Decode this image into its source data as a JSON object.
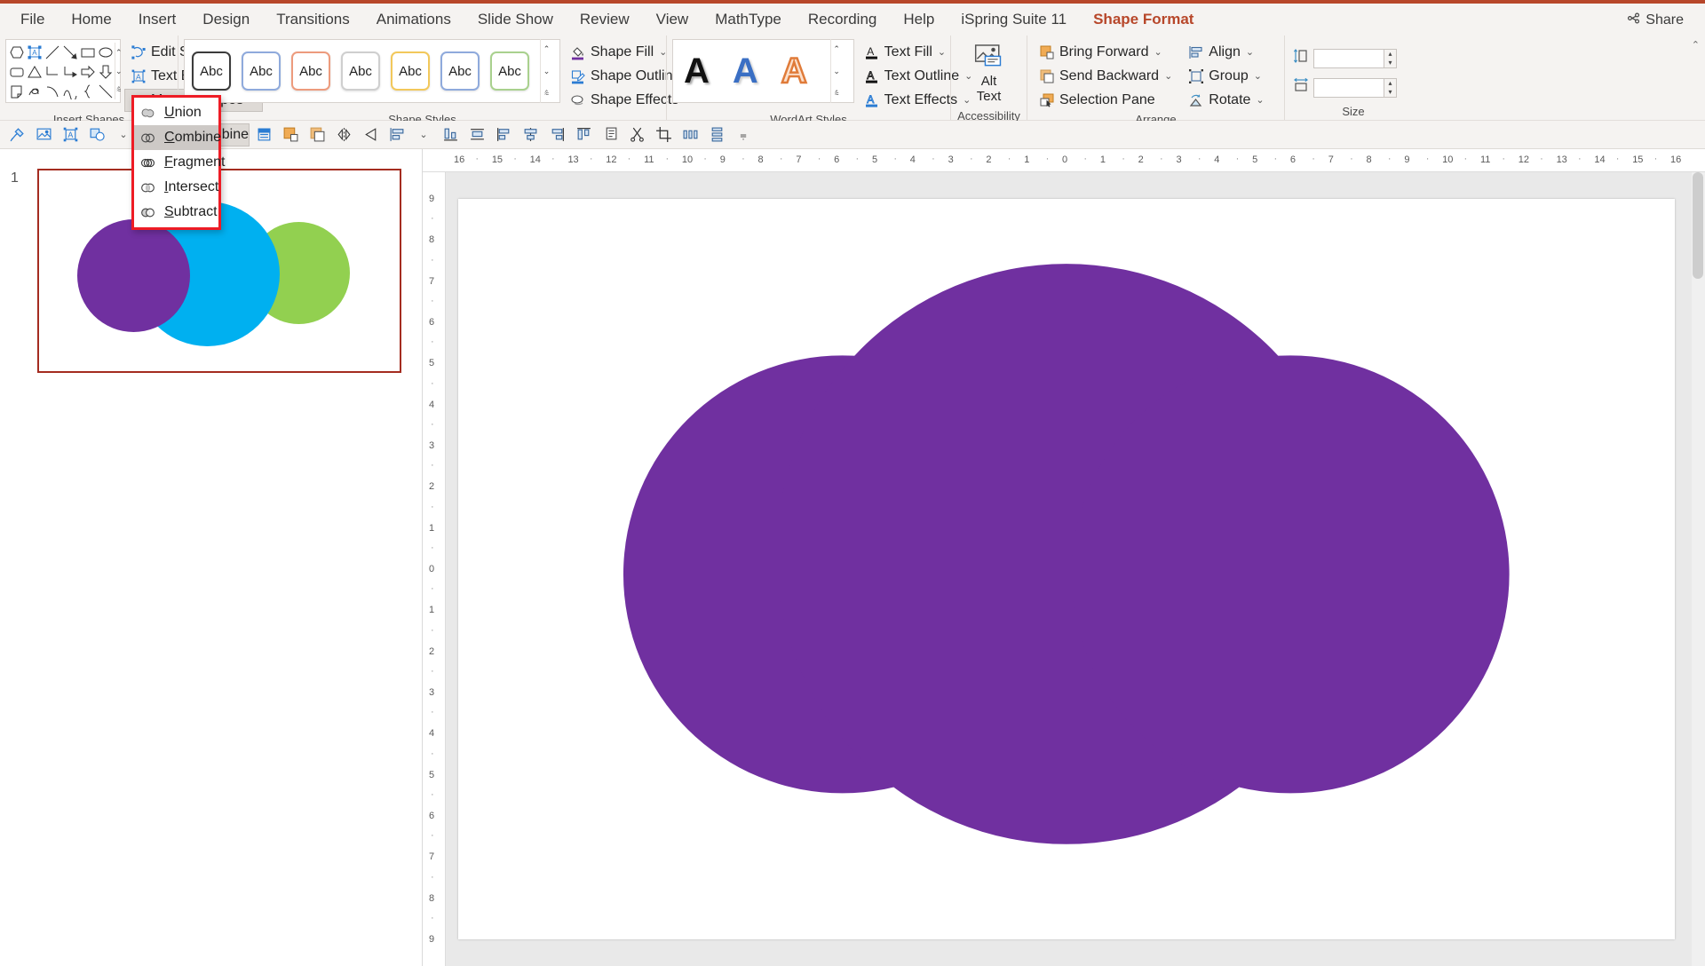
{
  "window": {
    "tabs": [
      {
        "label": "File",
        "active": false
      },
      {
        "label": "Home",
        "active": false
      },
      {
        "label": "Insert",
        "active": false
      },
      {
        "label": "Design",
        "active": false
      },
      {
        "label": "Transitions",
        "active": false
      },
      {
        "label": "Animations",
        "active": false
      },
      {
        "label": "Slide Show",
        "active": false
      },
      {
        "label": "Review",
        "active": false
      },
      {
        "label": "View",
        "active": false
      },
      {
        "label": "MathType",
        "active": false
      },
      {
        "label": "Recording",
        "active": false
      },
      {
        "label": "Help",
        "active": false
      },
      {
        "label": "iSpring Suite 11",
        "active": false
      },
      {
        "label": "Shape Format",
        "active": true
      }
    ],
    "share_label": "Share"
  },
  "ribbon": {
    "groups": [
      {
        "label": "Insert Shapes"
      },
      {
        "label": "Shape Styles"
      },
      {
        "label": "WordArt Styles"
      },
      {
        "label": "Accessibility"
      },
      {
        "label": "Arrange"
      },
      {
        "label": "Size"
      }
    ],
    "insert_shapes": {
      "edit_shape": "Edit Shape",
      "text_box": "Text Box",
      "merge_shapes": "Merge Shapes"
    },
    "shape_styles": {
      "swatch_label": "Abc",
      "swatch_colors": [
        "#3b3b3b",
        "#8faadc",
        "#ed9b7d",
        "#cfcfcf",
        "#f2c85b",
        "#8faadc",
        "#a9d18e"
      ],
      "shape_fill": "Shape Fill",
      "shape_outline": "Shape Outline",
      "shape_effects": "Shape Effects"
    },
    "wordart_styles": {
      "samples": [
        "A",
        "A",
        "A"
      ],
      "sample_colors": [
        "#111111",
        "#3a6fc4",
        "#e07b39"
      ],
      "text_fill": "Text Fill",
      "text_outline": "Text Outline",
      "text_effects": "Text Effects"
    },
    "accessibility": {
      "alt_text_line1": "Alt",
      "alt_text_line2": "Text"
    },
    "arrange": {
      "bring_forward": "Bring Forward",
      "send_backward": "Send Backward",
      "selection_pane": "Selection Pane",
      "align": "Align",
      "group": "Group",
      "rotate": "Rotate"
    },
    "size": {
      "height_value": "",
      "width_value": ""
    }
  },
  "merge_menu": {
    "items": [
      {
        "label": "Union",
        "accel": "U",
        "selected": false,
        "icon": "union-icon"
      },
      {
        "label": "Combine",
        "accel": "C",
        "selected": true,
        "icon": "combine-icon"
      },
      {
        "label": "Fragment",
        "accel": "F",
        "selected": false,
        "icon": "fragment-icon"
      },
      {
        "label": "Intersect",
        "accel": "I",
        "selected": false,
        "icon": "intersect-icon"
      },
      {
        "label": "Subtract",
        "accel": "S",
        "selected": false,
        "icon": "subtract-icon"
      }
    ]
  },
  "quick_toolbar": {
    "buttons": [
      "format-painter-icon",
      "insert-picture-icon",
      "text-box-icon",
      "shape-fill-icon",
      "size-icon",
      "merge-shapes-combine",
      "shape-styles-icon",
      "bring-forward-icon",
      "send-backward-icon",
      "flip-horizontal-icon",
      "flip-vertical-icon",
      "align-icon",
      "align-bottom-icon",
      "align-middle-icon",
      "align-left-icon",
      "align-center-icon",
      "align-right-icon",
      "align-top-icon",
      "duplicate-icon",
      "cut-icon",
      "crop-icon",
      "distribute-horizontal-icon",
      "distribute-vertical-icon",
      "more-options-icon"
    ],
    "combine_label": "Combine"
  },
  "slides": {
    "current_number": "1",
    "thumbnail_shapes": [
      {
        "name": "purple-circle",
        "color": "#7030A0"
      },
      {
        "name": "cyan-circle",
        "color": "#00B0F0"
      },
      {
        "name": "green-circle",
        "color": "#92D050"
      }
    ]
  },
  "canvas": {
    "shape_color": "#7030A0",
    "shape_name": "combined-venn-shape",
    "ruler_h_ticks": [
      "16",
      "15",
      "14",
      "13",
      "12",
      "11",
      "10",
      "9",
      "8",
      "7",
      "6",
      "5",
      "4",
      "3",
      "2",
      "1",
      "0",
      "1",
      "2",
      "3",
      "4",
      "5",
      "6",
      "7",
      "8",
      "9",
      "10",
      "11",
      "12",
      "13",
      "14",
      "15",
      "16"
    ],
    "ruler_v_ticks": [
      "9",
      "8",
      "7",
      "6",
      "5",
      "4",
      "3",
      "2",
      "1",
      "0",
      "1",
      "2",
      "3",
      "4",
      "5",
      "6",
      "7",
      "8",
      "9"
    ]
  }
}
